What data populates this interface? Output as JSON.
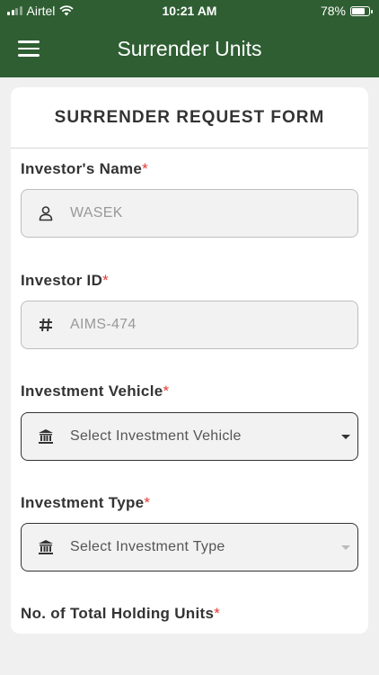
{
  "status": {
    "carrier": "Airtel",
    "time": "10:21 AM",
    "battery": "78%",
    "battery_level": 0.78
  },
  "app_bar": {
    "title": "Surrender Units",
    "menu_icon": "hamburger-menu-icon"
  },
  "form": {
    "title": "SURRENDER REQUEST FORM",
    "required_mark": "*",
    "fields": [
      {
        "label": "Investor's Name",
        "value": "WASEK",
        "icon": "user-icon"
      },
      {
        "label": "Investor ID",
        "value": "AIMS-474",
        "icon": "hash-icon"
      },
      {
        "label": "Investment Vehicle",
        "value": "Select Investment Vehicle",
        "icon": "bank-icon"
      },
      {
        "label": "Investment Type",
        "value": "Select Investment Type",
        "icon": "bank-icon"
      },
      {
        "label": "No. of Total Holding Units"
      }
    ]
  },
  "colors": {
    "header_green": "#2f5e33",
    "required_red": "#e53935"
  }
}
